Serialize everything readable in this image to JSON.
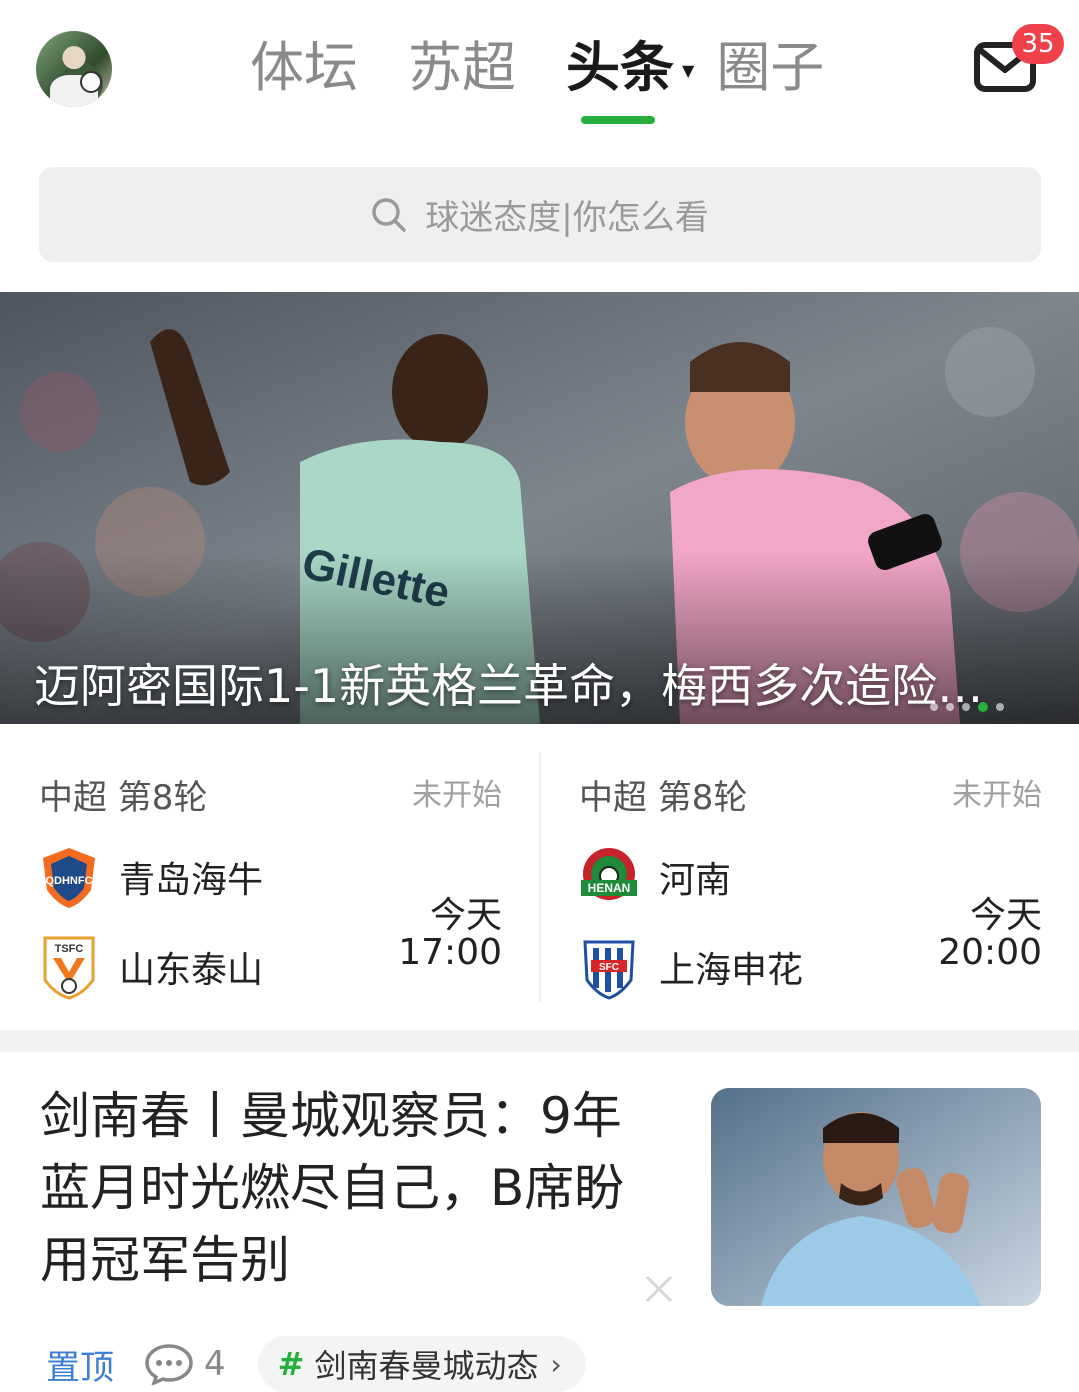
{
  "nav": {
    "tabs": [
      {
        "label": "体坛",
        "active": false
      },
      {
        "label": "苏超",
        "active": false
      },
      {
        "label": "头条",
        "active": true
      },
      {
        "label": "圈子",
        "active": false
      }
    ],
    "mail_badge": "35",
    "accent_color": "#25b03e",
    "badge_color": "#f0414b"
  },
  "search": {
    "placeholder": "球迷态度|你怎么看"
  },
  "hero": {
    "title": "迈阿密国际1-1新英格兰革命，梅西多次造险…",
    "dots_count": 5,
    "active_dot": 4
  },
  "matches": [
    {
      "league": "中超 第8轮",
      "status": "未开始",
      "home": {
        "name": "青岛海牛",
        "logo": "qingdao-hainiu-logo"
      },
      "away": {
        "name": "山东泰山",
        "logo": "shandong-taishan-logo"
      },
      "day": "今天",
      "time": "17:00"
    },
    {
      "league": "中超 第8轮",
      "status": "未开始",
      "home": {
        "name": "河南",
        "logo": "henan-logo"
      },
      "away": {
        "name": "上海申花",
        "logo": "shanghai-shenhua-logo"
      },
      "day": "今天",
      "time": "20:00"
    }
  ],
  "article": {
    "title": "剑南春丨曼城观察员：9年蓝月时光燃尽自己，B席盼用冠军告别",
    "pin_label": "置顶",
    "comment_count": "4",
    "topic": "剑南春曼城动态"
  }
}
